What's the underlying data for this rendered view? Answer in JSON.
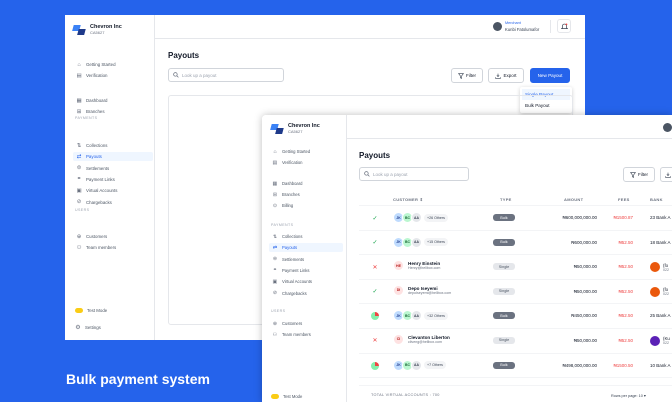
{
  "caption": "Bulk payment system",
  "back": {
    "company": "Chevron Inc",
    "company_id": "CA5627",
    "user_role": "Merchant",
    "user_name": "Kunbi Fatolumafor",
    "page_title": "Payouts",
    "search_placeholder": "Look up a payout",
    "filter_label": "Filter",
    "export_label": "Export",
    "new_payout_label": "New Payout",
    "dropdown": [
      "Single Payout",
      "Bulk Payout"
    ],
    "nav_top": [
      "Getting Started",
      "Verification"
    ],
    "nav_mid": [
      "Dashboard",
      "Branches"
    ],
    "payments_label": "PAYMENTS",
    "nav_payments": [
      "Collections",
      "Payouts",
      "Settlements",
      "Payment Links",
      "Virtual Accounts",
      "Chargebacks"
    ],
    "users_label": "USERS",
    "nav_users": [
      "Customers",
      "Team members"
    ],
    "test_mode": "Test Mode",
    "settings": "Settings"
  },
  "front": {
    "company": "Chevron Inc",
    "company_id": "CA5627",
    "page_title": "Payouts",
    "search_placeholder": "Look up a payout",
    "filter_label": "Filter",
    "nav_top": [
      "Getting Started",
      "Verification"
    ],
    "nav_mid": [
      "Dashboard",
      "Branches",
      "Billing"
    ],
    "payments_label": "PAYMENTS",
    "nav_payments": [
      "Collections",
      "Payouts",
      "Settlements",
      "Payment Links",
      "Virtual Accounts",
      "Chargebacks"
    ],
    "users_label": "USERS",
    "nav_users": [
      "Customers",
      "Team members"
    ],
    "test_mode": "Test Mode",
    "columns": {
      "customer": "CUSTOMER",
      "type": "TYPE",
      "amount": "AMOUNT",
      "fees": "FEES",
      "bank": "BANK"
    },
    "rows": [
      {
        "status": "success",
        "kind": "bulk",
        "avatars": [
          "JK",
          "BC",
          "AA"
        ],
        "others": "+26 Others",
        "type": "Bulk",
        "amount": "₦600,000,000.00",
        "fees": "₦1500.87",
        "bank": "23 Bank A"
      },
      {
        "status": "success",
        "kind": "bulk",
        "avatars": [
          "JK",
          "BC",
          "AA"
        ],
        "others": "+15 Others",
        "type": "Bulk",
        "amount": "₦600,000.00",
        "fees": "₦52.50",
        "bank": "18 Bank A"
      },
      {
        "status": "failed",
        "kind": "single",
        "initials": "HE",
        "name": "Henry Einstein",
        "email": "Henry@hellbox.com",
        "type": "Single",
        "amount": "₦50,000.00",
        "fees": "₦52.50",
        "bank": "(fo",
        "bank_sub": "022"
      },
      {
        "status": "success",
        "kind": "single",
        "initials": "DI",
        "name": "Depo Iseyemi",
        "email": "depoIseyemi@hellbox.com",
        "type": "Single",
        "amount": "₦50,000.00",
        "fees": "₦52.50",
        "bank": "(fo",
        "bank_sub": "022"
      },
      {
        "status": "partial",
        "kind": "bulk",
        "avatars": [
          "JK",
          "BC",
          "AA"
        ],
        "others": "+32 Others",
        "type": "Bulk",
        "amount": "₦450,000.00",
        "fees": "₦52.50",
        "bank": "25 Bank A"
      },
      {
        "status": "failed",
        "kind": "single",
        "initials": "CI",
        "name": "Clevanton Liberton",
        "email": "cliveng@hellbox.com",
        "type": "Single",
        "amount": "₦50,000.00",
        "fees": "₦52.50",
        "bank": "(Ku",
        "bank_sub": "022"
      },
      {
        "status": "partial",
        "kind": "bulk",
        "avatars": [
          "JK",
          "BC",
          "AA"
        ],
        "others": "+7 Others",
        "type": "Bulk",
        "amount": "₦498,000,000.00",
        "fees": "₦1500.50",
        "bank": "10 Bank A"
      }
    ],
    "total_label": "TOTAL VIRTUAL ACCOUNTS : 700",
    "rows_per_page": "Rows per page: 10 ▾"
  },
  "colors": {
    "primary": "#2563eb",
    "success": "#16a34a",
    "failed": "#ef4444",
    "toggle": "#facc15"
  }
}
